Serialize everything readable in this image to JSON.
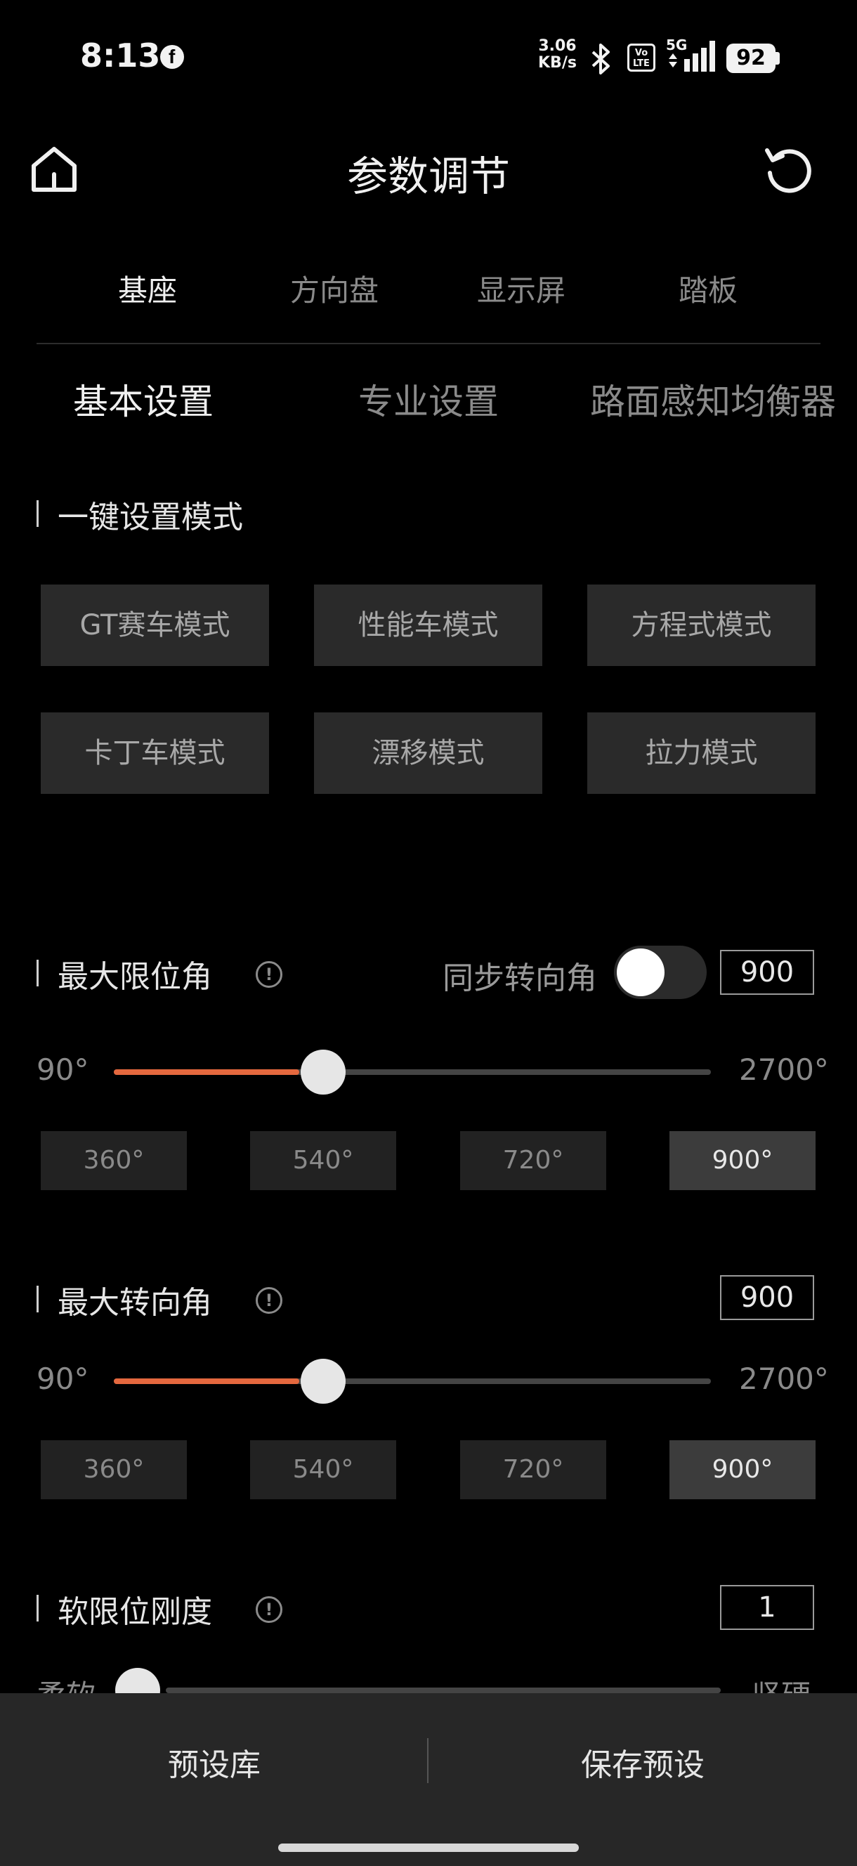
{
  "status_bar": {
    "time": "8:13",
    "net_speed_value": "3.06",
    "net_speed_unit": "KB/s",
    "volte": "Vo LTE",
    "network": "5G",
    "battery": "92"
  },
  "header": {
    "title": "参数调节",
    "home_icon": "home-icon",
    "reset_icon": "refresh-icon"
  },
  "top_tabs": [
    "基座",
    "方向盘",
    "显示屏",
    "踏板"
  ],
  "sub_tabs": [
    "基本设置",
    "专业设置",
    "路面感知均衡器"
  ],
  "one_key": {
    "title": "一键设置模式",
    "modes": [
      "GT赛车模式",
      "性能车模式",
      "方程式模式",
      "卡丁车模式",
      "漂移模式",
      "拉力模式"
    ]
  },
  "max_limit": {
    "title": "最大限位角",
    "sync_label": "同步转向角",
    "sync_on": false,
    "value": "900",
    "min_label": "90°",
    "max_label": "2700°",
    "min": 90,
    "max": 2700,
    "current": 900,
    "presets": [
      "360°",
      "540°",
      "720°",
      "900°"
    ],
    "active_preset": 3
  },
  "max_steer": {
    "title": "最大转向角",
    "value": "900",
    "min_label": "90°",
    "max_label": "2700°",
    "min": 90,
    "max": 2700,
    "current": 900,
    "presets": [
      "360°",
      "540°",
      "720°",
      "900°"
    ],
    "active_preset": 3
  },
  "soft_limit": {
    "title": "软限位刚度",
    "value": "1",
    "min_label": "柔软",
    "max_label": "坚硬"
  },
  "bottom": {
    "left": "预设库",
    "right": "保存预设"
  },
  "colors": {
    "accent": "#e4683e",
    "background": "#000000",
    "button_bg": "#2a2a2a"
  }
}
